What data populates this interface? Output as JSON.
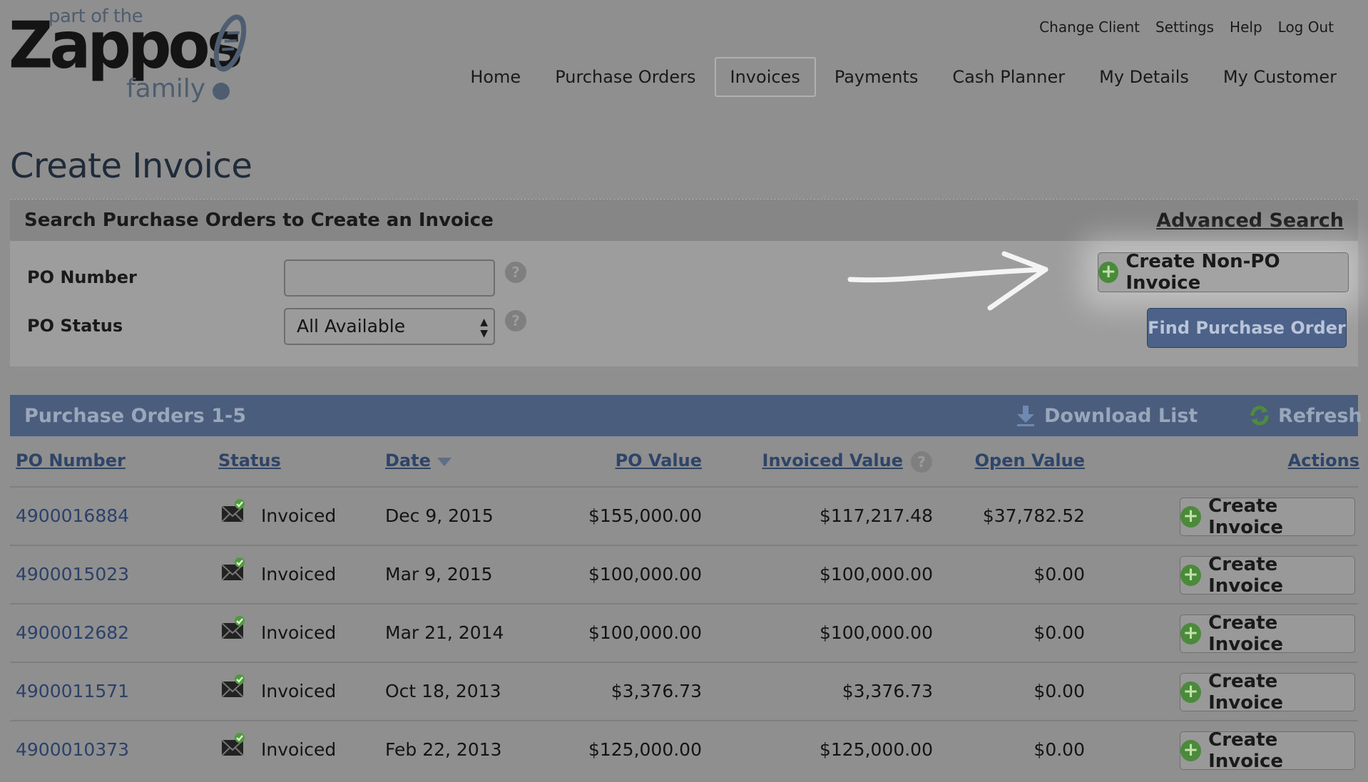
{
  "logo": {
    "part_of_the": "part of the",
    "brand": "Zappos",
    "family": "family"
  },
  "top_links": [
    "Change Client",
    "Settings",
    "Help",
    "Log Out"
  ],
  "nav": [
    {
      "label": "Home",
      "active": false
    },
    {
      "label": "Purchase Orders",
      "active": false
    },
    {
      "label": "Invoices",
      "active": true
    },
    {
      "label": "Payments",
      "active": false
    },
    {
      "label": "Cash Planner",
      "active": false
    },
    {
      "label": "My Details",
      "active": false
    },
    {
      "label": "My Customer",
      "active": false
    }
  ],
  "page_title": "Create Invoice",
  "search": {
    "title": "Search Purchase Orders to Create an Invoice",
    "advanced_link": "Advanced Search",
    "po_number_label": "PO Number",
    "po_number_value": "",
    "po_status_label": "PO Status",
    "po_status_value": "All Available",
    "create_non_po_label": "Create Non-PO Invoice",
    "find_po_label": "Find Purchase Order"
  },
  "table": {
    "title": "Purchase Orders 1-5",
    "download_label": "Download List",
    "refresh_label": "Refresh",
    "columns": {
      "po_number": "PO Number",
      "status": "Status",
      "date": "Date",
      "po_value": "PO Value",
      "invoiced_value": "Invoiced Value",
      "open_value": "Open Value",
      "actions": "Actions"
    },
    "action_label": "Create Invoice",
    "rows": [
      {
        "po": "4900016884",
        "status": "Invoiced",
        "date": "Dec 9, 2015",
        "po_value": "$155,000.00",
        "invoiced": "$117,217.48",
        "open": "$37,782.52"
      },
      {
        "po": "4900015023",
        "status": "Invoiced",
        "date": "Mar 9, 2015",
        "po_value": "$100,000.00",
        "invoiced": "$100,000.00",
        "open": "$0.00"
      },
      {
        "po": "4900012682",
        "status": "Invoiced",
        "date": "Mar 21, 2014",
        "po_value": "$100,000.00",
        "invoiced": "$100,000.00",
        "open": "$0.00"
      },
      {
        "po": "4900011571",
        "status": "Invoiced",
        "date": "Oct 18, 2013",
        "po_value": "$3,376.73",
        "invoiced": "$3,376.73",
        "open": "$0.00"
      },
      {
        "po": "4900010373",
        "status": "Invoiced",
        "date": "Feb 22, 2013",
        "po_value": "$125,000.00",
        "invoiced": "$125,000.00",
        "open": "$0.00"
      }
    ]
  },
  "colors": {
    "header_blue": "#4a5d7d",
    "link_blue": "#2b4169",
    "plus_green": "#4a8a3a"
  }
}
